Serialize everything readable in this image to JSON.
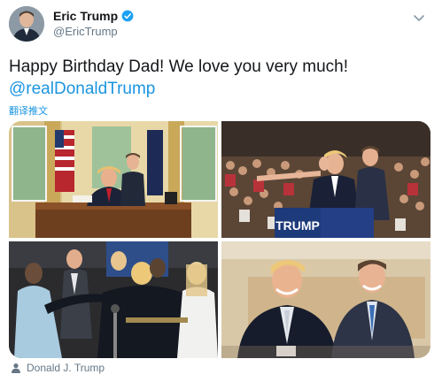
{
  "author": {
    "display_name": "Eric Trump",
    "handle": "@EricTrump",
    "verified": true
  },
  "tweet": {
    "text": "Happy Birthday Dad! We love you very much!",
    "mention": "@realDonaldTrump",
    "translate_label": "翻译推文"
  },
  "media": {
    "photos": [
      {
        "name": "oval-office-photo",
        "sign_text": ""
      },
      {
        "name": "rally-photo",
        "sign_text": "TRUMP"
      },
      {
        "name": "family-embrace-photo",
        "sign_text": ""
      },
      {
        "name": "smiling-duo-photo",
        "sign_text": ""
      }
    ]
  },
  "tagged": {
    "name": "Donald J. Trump"
  },
  "colors": {
    "link": "#1b95e0",
    "secondary_text": "#657786",
    "verified_badge": "#1da1f2"
  }
}
